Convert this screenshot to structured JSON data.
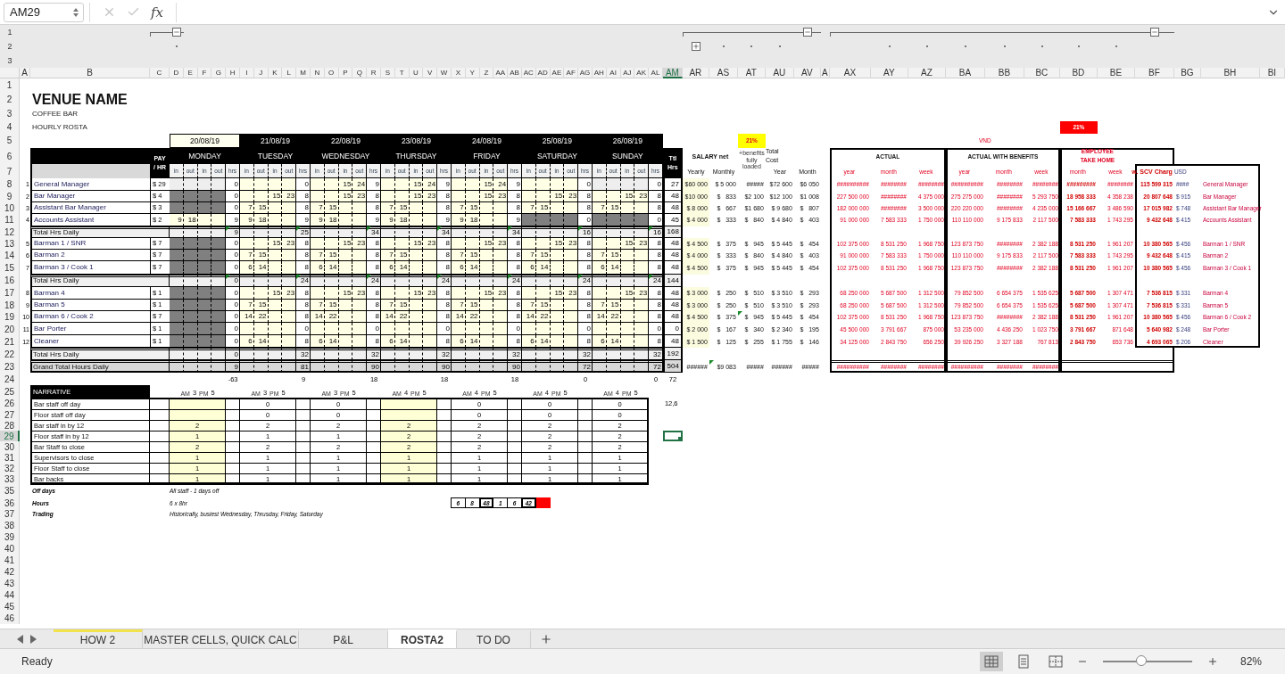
{
  "formula_bar": {
    "name_box": "AM29",
    "fx": "fx"
  },
  "outline": {
    "levels": [
      "1",
      "2",
      "3"
    ],
    "groups": [
      {
        "expanded": true
      },
      {
        "expanded": true
      },
      {
        "expanded": false
      },
      {
        "expanded": true
      }
    ]
  },
  "columns": [
    {
      "label": "A",
      "selected": false
    },
    {
      "label": "B",
      "selected": false
    },
    {
      "label": "C",
      "selected": false
    },
    {
      "label": "D",
      "selected": false
    },
    {
      "label": "E",
      "selected": false
    },
    {
      "label": "F",
      "selected": false
    },
    {
      "label": "G",
      "selected": false
    },
    {
      "label": "H",
      "selected": false
    },
    {
      "label": "I",
      "selected": false
    },
    {
      "label": "J",
      "selected": false
    },
    {
      "label": "K",
      "selected": false
    },
    {
      "label": "L",
      "selected": false
    },
    {
      "label": "M",
      "selected": false
    },
    {
      "label": "N",
      "selected": false
    },
    {
      "label": "O",
      "selected": false
    },
    {
      "label": "P",
      "selected": false
    },
    {
      "label": "Q",
      "selected": false
    },
    {
      "label": "R",
      "selected": false
    },
    {
      "label": "S",
      "selected": false
    },
    {
      "label": "T",
      "selected": false
    },
    {
      "label": "U",
      "selected": false
    },
    {
      "label": "V",
      "selected": false
    },
    {
      "label": "W",
      "selected": false
    },
    {
      "label": "X",
      "selected": false
    },
    {
      "label": "Y",
      "selected": false
    },
    {
      "label": "Z",
      "selected": false
    },
    {
      "label": "AA",
      "selected": false
    },
    {
      "label": "AB",
      "selected": false
    },
    {
      "label": "AC",
      "selected": false
    },
    {
      "label": "AD",
      "selected": false
    },
    {
      "label": "AE",
      "selected": false
    },
    {
      "label": "AF",
      "selected": false
    },
    {
      "label": "AG",
      "selected": false
    },
    {
      "label": "AH",
      "selected": false
    },
    {
      "label": "AI",
      "selected": false
    },
    {
      "label": "AJ",
      "selected": false
    },
    {
      "label": "AK",
      "selected": false
    },
    {
      "label": "AL",
      "selected": false
    },
    {
      "label": "AM",
      "selected": true
    },
    {
      "label": "AR",
      "selected": false
    },
    {
      "label": "AS",
      "selected": false
    },
    {
      "label": "AT",
      "selected": false
    },
    {
      "label": "AU",
      "selected": false
    },
    {
      "label": "AV",
      "selected": false
    },
    {
      "label": "A",
      "selected": false
    },
    {
      "label": "AX",
      "selected": false
    },
    {
      "label": "AY",
      "selected": false
    },
    {
      "label": "AZ",
      "selected": false
    },
    {
      "label": "BA",
      "selected": false
    },
    {
      "label": "BB",
      "selected": false
    },
    {
      "label": "BC",
      "selected": false
    },
    {
      "label": "BD",
      "selected": false
    },
    {
      "label": "BE",
      "selected": false
    },
    {
      "label": "BF",
      "selected": false
    },
    {
      "label": "BG",
      "selected": false
    },
    {
      "label": "BH",
      "selected": false
    },
    {
      "label": "BI",
      "selected": false
    }
  ],
  "rows": [
    {
      "label": "1",
      "selected": false
    },
    {
      "label": "2",
      "selected": false
    },
    {
      "label": "3",
      "selected": false
    },
    {
      "label": "4",
      "selected": false
    },
    {
      "label": "5",
      "selected": false
    },
    {
      "label": "6",
      "selected": false
    },
    {
      "label": "7",
      "selected": false
    },
    {
      "label": "8",
      "selected": false
    },
    {
      "label": "9",
      "selected": false
    },
    {
      "label": "10",
      "selected": false
    },
    {
      "label": "11",
      "selected": false
    },
    {
      "label": "12",
      "selected": false
    },
    {
      "label": "13",
      "selected": false
    },
    {
      "label": "14",
      "selected": false
    },
    {
      "label": "15",
      "selected": false
    },
    {
      "label": "16",
      "selected": false
    },
    {
      "label": "17",
      "selected": false
    },
    {
      "label": "18",
      "selected": false
    },
    {
      "label": "19",
      "selected": false
    },
    {
      "label": "20",
      "selected": false
    },
    {
      "label": "21",
      "selected": false
    },
    {
      "label": "22",
      "selected": false
    },
    {
      "label": "23",
      "selected": false
    },
    {
      "label": "24",
      "selected": false
    },
    {
      "label": "25",
      "selected": false
    },
    {
      "label": "26",
      "selected": false
    },
    {
      "label": "27",
      "selected": false
    },
    {
      "label": "28",
      "selected": false
    },
    {
      "label": "29",
      "selected": true
    },
    {
      "label": "30",
      "selected": false
    },
    {
      "label": "31",
      "selected": false
    },
    {
      "label": "32",
      "selected": false
    },
    {
      "label": "33",
      "selected": false
    },
    {
      "label": "35",
      "selected": false
    },
    {
      "label": "36",
      "selected": false
    },
    {
      "label": "37",
      "selected": false
    },
    {
      "label": "38",
      "selected": false
    },
    {
      "label": "39",
      "selected": false
    },
    {
      "label": "40",
      "selected": false
    },
    {
      "label": "41",
      "selected": false
    },
    {
      "label": "42",
      "selected": false
    },
    {
      "label": "43",
      "selected": false
    },
    {
      "label": "44",
      "selected": false
    },
    {
      "label": "45",
      "selected": false
    },
    {
      "label": "46",
      "selected": false
    }
  ],
  "title": "VENUE NAME",
  "subtitle": "COFFEE BAR",
  "sheet_name": "HOURLY ROSTA",
  "roster": {
    "pay_header": [
      "PAY",
      "/ HR"
    ],
    "total_header": [
      "Ttl",
      "Hrs"
    ],
    "days": [
      {
        "date": "20/08/19",
        "name": "MONDAY",
        "highlighted": true,
        "subheaders": [
          "in",
          "out",
          "in",
          "out",
          "hrs"
        ]
      },
      {
        "date": "21/08/19",
        "name": "TUESDAY",
        "highlighted": false,
        "subheaders": [
          "in",
          "out",
          "in",
          "out",
          "hrs"
        ]
      },
      {
        "date": "22/08/19",
        "name": "WEDNESDAY",
        "highlighted": false,
        "subheaders": [
          "in",
          "out",
          "in",
          "out",
          "hrs"
        ]
      },
      {
        "date": "23/08/19",
        "name": "THURSDAY",
        "highlighted": false,
        "subheaders": [
          "in",
          "out",
          "in",
          "out",
          "hrs"
        ]
      },
      {
        "date": "24/08/19",
        "name": "FRIDAY",
        "highlighted": false,
        "subheaders": [
          "in",
          "out",
          "in",
          "out",
          "hrs"
        ]
      },
      {
        "date": "25/08/19",
        "name": "SATURDAY",
        "highlighted": false,
        "subheaders": [
          "in",
          "out",
          "in",
          "out",
          "hrs"
        ]
      },
      {
        "date": "26/08/19",
        "name": "SUNDAY",
        "highlighted": false,
        "subheaders": [
          "in",
          "out",
          "in",
          "out",
          "hrs"
        ]
      }
    ],
    "groups": [
      {
        "staff": [
          {
            "no": "1",
            "name": "General Manager",
            "pay": "$ 29",
            "total": "27",
            "shifts": [
              {
                "kind": "empty",
                "hrs": "0"
              },
              {
                "kind": "work",
                "hrs": "0"
              },
              {
                "kind": "work",
                "second": [
                  "15",
                  "24"
                ],
                "hrs": "9"
              },
              {
                "kind": "work",
                "second": [
                  "15",
                  "24"
                ],
                "hrs": "9"
              },
              {
                "kind": "work",
                "second": [
                  "15",
                  "24"
                ],
                "hrs": "9"
              },
              {
                "kind": "work",
                "hrs": "0"
              },
              {
                "kind": "empty",
                "hrs": "0"
              }
            ]
          },
          {
            "no": "2",
            "name": "Bar Manager",
            "pay": "$ 4",
            "total": "48",
            "shifts": [
              {
                "kind": "off",
                "hrs": "0"
              },
              {
                "kind": "work",
                "second": [
                  "15",
                  "23"
                ],
                "hrs": "8"
              },
              {
                "kind": "work",
                "second": [
                  "15",
                  "23"
                ],
                "hrs": "8"
              },
              {
                "kind": "work",
                "second": [
                  "15",
                  "23"
                ],
                "hrs": "8"
              },
              {
                "kind": "work",
                "second": [
                  "15",
                  "23"
                ],
                "hrs": "8"
              },
              {
                "kind": "work",
                "second": [
                  "15",
                  "23"
                ],
                "hrs": "8"
              },
              {
                "kind": "work",
                "second": [
                  "15",
                  "23"
                ],
                "hrs": "8"
              }
            ]
          },
          {
            "no": "3",
            "name": "Assistant Bar Manager",
            "pay": "$ 3",
            "total": "48",
            "shifts": [
              {
                "kind": "off",
                "hrs": "0"
              },
              {
                "kind": "work",
                "first": [
                  "7",
                  "15"
                ],
                "hrs": "8"
              },
              {
                "kind": "work",
                "first": [
                  "7",
                  "15"
                ],
                "hrs": "8"
              },
              {
                "kind": "work",
                "first": [
                  "7",
                  "15"
                ],
                "hrs": "8"
              },
              {
                "kind": "work",
                "first": [
                  "7",
                  "15"
                ],
                "hrs": "8"
              },
              {
                "kind": "work",
                "first": [
                  "7",
                  "15"
                ],
                "hrs": "8"
              },
              {
                "kind": "work",
                "first": [
                  "7",
                  "15"
                ],
                "hrs": "8"
              }
            ]
          },
          {
            "no": "4",
            "name": "Accounts Assistant",
            "pay": "$ 2",
            "total": "45",
            "shifts": [
              {
                "kind": "work",
                "first": [
                  "9",
                  "18"
                ],
                "hrs": "9"
              },
              {
                "kind": "work",
                "first": [
                  "9",
                  "18"
                ],
                "hrs": "9"
              },
              {
                "kind": "work",
                "first": [
                  "9",
                  "18"
                ],
                "hrs": "9"
              },
              {
                "kind": "work",
                "first": [
                  "9",
                  "18"
                ],
                "hrs": "9"
              },
              {
                "kind": "work",
                "first": [
                  "9",
                  "18"
                ],
                "hrs": "9"
              },
              {
                "kind": "off",
                "hrs": "0"
              },
              {
                "kind": "off",
                "hrs": "0"
              }
            ]
          }
        ],
        "total": {
          "label": "Total Hrs Daily",
          "flagged": true,
          "days": [
            "9",
            "25",
            "34",
            "34",
            "34",
            "16",
            "16"
          ],
          "total": "168"
        }
      },
      {
        "staff": [
          {
            "no": "5",
            "name": "Barman 1 / SNR",
            "pay": "$ 7",
            "total": "48",
            "shifts": [
              {
                "kind": "off",
                "hrs": "0"
              },
              {
                "kind": "work",
                "second": [
                  "15",
                  "23"
                ],
                "hrs": "8"
              },
              {
                "kind": "work",
                "second": [
                  "15",
                  "23"
                ],
                "hrs": "8"
              },
              {
                "kind": "work",
                "second": [
                  "15",
                  "23"
                ],
                "hrs": "8"
              },
              {
                "kind": "work",
                "second": [
                  "15",
                  "23"
                ],
                "hrs": "8"
              },
              {
                "kind": "work",
                "second": [
                  "15",
                  "23"
                ],
                "hrs": "8"
              },
              {
                "kind": "work",
                "second": [
                  "15",
                  "23"
                ],
                "hrs": "8"
              }
            ]
          },
          {
            "no": "6",
            "name": "Barman 2",
            "pay": "$ 7",
            "total": "48",
            "shifts": [
              {
                "kind": "off",
                "hrs": "0"
              },
              {
                "kind": "work",
                "first": [
                  "7",
                  "15"
                ],
                "hrs": "8"
              },
              {
                "kind": "work",
                "first": [
                  "7",
                  "15"
                ],
                "hrs": "8"
              },
              {
                "kind": "work",
                "first": [
                  "7",
                  "15"
                ],
                "hrs": "8"
              },
              {
                "kind": "work",
                "first": [
                  "7",
                  "15"
                ],
                "hrs": "8"
              },
              {
                "kind": "work",
                "first": [
                  "7",
                  "15"
                ],
                "hrs": "8"
              },
              {
                "kind": "work",
                "first": [
                  "7",
                  "15"
                ],
                "hrs": "8"
              }
            ]
          },
          {
            "no": "7",
            "name": "Barman 3 / Cook 1",
            "pay": "$ 7",
            "total": "48",
            "shifts": [
              {
                "kind": "off",
                "hrs": "0"
              },
              {
                "kind": "work",
                "first": [
                  "6",
                  "14"
                ],
                "hrs": "8"
              },
              {
                "kind": "work",
                "first": [
                  "6",
                  "14"
                ],
                "hrs": "8"
              },
              {
                "kind": "work",
                "first": [
                  "6",
                  "14"
                ],
                "hrs": "8"
              },
              {
                "kind": "work",
                "first": [
                  "6",
                  "14"
                ],
                "hrs": "8"
              },
              {
                "kind": "work",
                "first": [
                  "6",
                  "14"
                ],
                "hrs": "8"
              },
              {
                "kind": "work",
                "first": [
                  "6",
                  "14"
                ],
                "hrs": "8"
              }
            ]
          }
        ],
        "total": {
          "label": "Total Hrs Daily",
          "flagged": true,
          "days": [
            "0",
            "24",
            "24",
            "24",
            "24",
            "24",
            "24"
          ],
          "total": "144"
        }
      },
      {
        "staff": [
          {
            "no": "8",
            "name": "Barman 4",
            "pay": "$ 1",
            "total": "48",
            "shifts": [
              {
                "kind": "off",
                "hrs": "0"
              },
              {
                "kind": "work",
                "second": [
                  "15",
                  "23"
                ],
                "hrs": "8"
              },
              {
                "kind": "work",
                "second": [
                  "15",
                  "23"
                ],
                "hrs": "8"
              },
              {
                "kind": "work",
                "second": [
                  "15",
                  "23"
                ],
                "hrs": "8"
              },
              {
                "kind": "work",
                "second": [
                  "15",
                  "23"
                ],
                "hrs": "8"
              },
              {
                "kind": "work",
                "second": [
                  "15",
                  "23"
                ],
                "hrs": "8"
              },
              {
                "kind": "work",
                "second": [
                  "15",
                  "23"
                ],
                "hrs": "8"
              }
            ]
          },
          {
            "no": "9",
            "name": "Barman 5",
            "pay": "$ 1",
            "total": "48",
            "shifts": [
              {
                "kind": "off",
                "hrs": "0"
              },
              {
                "kind": "work",
                "first": [
                  "7",
                  "15"
                ],
                "hrs": "8"
              },
              {
                "kind": "work",
                "first": [
                  "7",
                  "15"
                ],
                "hrs": "8"
              },
              {
                "kind": "work",
                "first": [
                  "7",
                  "15"
                ],
                "hrs": "8"
              },
              {
                "kind": "work",
                "first": [
                  "7",
                  "15"
                ],
                "hrs": "8"
              },
              {
                "kind": "work",
                "first": [
                  "7",
                  "15"
                ],
                "hrs": "8"
              },
              {
                "kind": "work",
                "first": [
                  "7",
                  "15"
                ],
                "hrs": "8"
              }
            ]
          },
          {
            "no": "10",
            "name": "Barman 6 / Cook 2",
            "pay": "$ 7",
            "total": "48",
            "shifts": [
              {
                "kind": "off",
                "hrs": "0"
              },
              {
                "kind": "work",
                "first": [
                  "14",
                  "22"
                ],
                "hrs": "8"
              },
              {
                "kind": "work",
                "first": [
                  "14",
                  "22"
                ],
                "hrs": "8"
              },
              {
                "kind": "work",
                "first": [
                  "14",
                  "22"
                ],
                "hrs": "8"
              },
              {
                "kind": "work",
                "first": [
                  "14",
                  "22"
                ],
                "hrs": "8"
              },
              {
                "kind": "work",
                "first": [
                  "14",
                  "22"
                ],
                "hrs": "8"
              },
              {
                "kind": "work",
                "first": [
                  "14",
                  "22"
                ],
                "hrs": "8"
              }
            ]
          },
          {
            "no": "11",
            "name": "Bar Porter",
            "pay": "$ 1",
            "total": "0",
            "shifts": [
              {
                "kind": "off",
                "hrs": "0"
              },
              {
                "kind": "work",
                "hrs": "0"
              },
              {
                "kind": "work",
                "hrs": "0"
              },
              {
                "kind": "work",
                "hrs": "0"
              },
              {
                "kind": "work",
                "hrs": "0"
              },
              {
                "kind": "work",
                "hrs": "0"
              },
              {
                "kind": "work",
                "hrs": "0"
              }
            ]
          },
          {
            "no": "12",
            "name": "Cleaner",
            "pay": "$ 1",
            "total": "48",
            "shifts": [
              {
                "kind": "off",
                "hrs": "0"
              },
              {
                "kind": "work",
                "first": [
                  "6",
                  "14"
                ],
                "hrs": "8"
              },
              {
                "kind": "work",
                "first": [
                  "6",
                  "14"
                ],
                "hrs": "8"
              },
              {
                "kind": "work",
                "first": [
                  "6",
                  "14"
                ],
                "hrs": "8"
              },
              {
                "kind": "work",
                "first": [
                  "6",
                  "14"
                ],
                "hrs": "8"
              },
              {
                "kind": "work",
                "first": [
                  "6",
                  "14"
                ],
                "hrs": "8"
              },
              {
                "kind": "work",
                "first": [
                  "6",
                  "14"
                ],
                "hrs": "8"
              }
            ]
          }
        ],
        "total": {
          "label": "Total Hrs Daily",
          "flagged": false,
          "days": [
            "0",
            "32",
            "32",
            "32",
            "32",
            "32",
            "32"
          ],
          "total": "192"
        }
      }
    ],
    "grand_total": {
      "label": "Grand Total Hours Daily",
      "days": [
        "9",
        "81",
        "90",
        "90",
        "90",
        "72",
        "72"
      ],
      "total": "504"
    },
    "balance": {
      "days": [
        "-63",
        "9",
        "18",
        "18",
        "18",
        "0",
        "0"
      ],
      "total": "72"
    }
  },
  "salary": {
    "rate_badge": "21%",
    "title": "SALARY net",
    "benefits_note": "+benefits fully loaded",
    "total_cost": [
      "Total",
      "Cost"
    ],
    "columns": [
      "Yearly",
      "Monthly",
      "Year",
      "Month"
    ],
    "rows": [
      {
        "yearly": "$60 000",
        "monthly": "$ 5 000",
        "benefits": "#####",
        "year": "$72 600",
        "month": "$6 050",
        "flagged": false
      },
      {
        "yearly": "$10 000",
        "monthly": "$   833",
        "benefits": "$2 100",
        "year": "$12 100",
        "month": "$1 008",
        "flagged": false
      },
      {
        "yearly": "$ 8 000",
        "monthly": "$   667",
        "benefits": "$1 680",
        "year": "$ 9 680",
        "month": "$   807",
        "flagged": false
      },
      {
        "yearly": "$ 4 000",
        "monthly": "$   333",
        "benefits": "$   840",
        "year": "$ 4 840",
        "month": "$   403",
        "flagged": false
      },
      {
        "yearly": "$ 4 500",
        "monthly": "$   375",
        "benefits": "$   945",
        "year": "$ 5 445",
        "month": "$   454",
        "flagged": false
      },
      {
        "yearly": "$ 4 000",
        "monthly": "$   333",
        "benefits": "$   840",
        "year": "$ 4 840",
        "month": "$   403",
        "flagged": false
      },
      {
        "yearly": "$ 4 500",
        "monthly": "$   375",
        "benefits": "$   945",
        "year": "$ 5 445",
        "month": "$   454",
        "flagged": false
      },
      {
        "yearly": "$ 3 000",
        "monthly": "$   250",
        "benefits": "$   510",
        "year": "$ 3 510",
        "month": "$   293",
        "flagged": false
      },
      {
        "yearly": "$ 3 000",
        "monthly": "$   250",
        "benefits": "$   510",
        "year": "$ 3 510",
        "month": "$   293",
        "flagged": false
      },
      {
        "yearly": "$ 4 500",
        "monthly": "$   375",
        "benefits": "$   945",
        "year": "$ 5 445",
        "month": "$   454",
        "flagged": true
      },
      {
        "yearly": "$ 2 000",
        "monthly": "$   167",
        "benefits": "$   340",
        "year": "$ 2 340",
        "month": "$   195",
        "flagged": false
      },
      {
        "yearly": "$ 1 500",
        "monthly": "$   125",
        "benefits": "$   255",
        "year": "$ 1 755",
        "month": "$   146",
        "flagged": false
      }
    ],
    "grand": {
      "yearly": "######",
      "monthly": "$9 083",
      "benefits": "#####",
      "year": "######",
      "month": "#####",
      "flagged": true
    }
  },
  "vnd": {
    "currency": "VND",
    "actual_title": "ACTUAL",
    "benefits_title": "ACTUAL WITH BENEFITS",
    "actual_columns": [
      "year",
      "month",
      "week"
    ],
    "benefits_columns": [
      "year",
      "month",
      "week"
    ],
    "rows": [
      {
        "actual": [
          "##########",
          "########",
          "########"
        ],
        "benefits": [
          "##########",
          "########",
          "########"
        ]
      },
      {
        "actual": [
          "227 500 000",
          "########",
          "4 375 000"
        ],
        "benefits": [
          "275 275 000",
          "########",
          "5 293 750"
        ]
      },
      {
        "actual": [
          "182 000 000",
          "########",
          "3 500 000"
        ],
        "benefits": [
          "220 220 000",
          "########",
          "4 235 000"
        ]
      },
      {
        "actual": [
          "91 000 000",
          "7 583 333",
          "1 750 000"
        ],
        "benefits": [
          "110 110 000",
          "9 175 833",
          "2 117 500"
        ]
      },
      {
        "actual": [
          "102 375 000",
          "8 531 250",
          "1 968 750"
        ],
        "benefits": [
          "123 873 750",
          "########",
          "2 382 188"
        ]
      },
      {
        "actual": [
          "91 000 000",
          "7 583 333",
          "1 750 000"
        ],
        "benefits": [
          "110 110 000",
          "9 175 833",
          "2 117 500"
        ]
      },
      {
        "actual": [
          "102 375 000",
          "8 531 250",
          "1 968 750"
        ],
        "benefits": [
          "123 873 750",
          "########",
          "2 382 188"
        ]
      },
      {
        "actual": [
          "68 250 000",
          "5 687 500",
          "1 312 500"
        ],
        "benefits": [
          "79 852 500",
          "6 654 375",
          "1 535 625"
        ]
      },
      {
        "actual": [
          "68 250 000",
          "5 687 500",
          "1 312 500"
        ],
        "benefits": [
          "79 852 500",
          "6 654 375",
          "1 535 625"
        ]
      },
      {
        "actual": [
          "102 375 000",
          "8 531 250",
          "1 968 750"
        ],
        "benefits": [
          "123 873 750",
          "########",
          "2 382 188"
        ]
      },
      {
        "actual": [
          "45 500 000",
          "3 791 667",
          "875 000"
        ],
        "benefits": [
          "53 235 000",
          "4 436 250",
          "1 023 750"
        ]
      },
      {
        "actual": [
          "34 125 000",
          "2 843 750",
          "656 250"
        ],
        "benefits": [
          "39 926 250",
          "3 327 188",
          "767 813"
        ]
      }
    ],
    "grand": {
      "actual": [
        "##########",
        "########",
        "########"
      ],
      "benefits": [
        "##########",
        "########",
        "########"
      ]
    }
  },
  "take_home": {
    "rate_badge": "21%",
    "title": [
      "EMPLOYEE",
      "TAKE HOME"
    ],
    "columns": [
      "month",
      "week"
    ],
    "rows": [
      [
        "#########",
        "########"
      ],
      [
        "18 958 333",
        "4 358 238"
      ],
      [
        "15 166 667",
        "3 486 590"
      ],
      [
        "7 583 333",
        "1 743 295"
      ],
      [
        "8 531 250",
        "1 961 207"
      ],
      [
        "7 583 333",
        "1 743 295"
      ],
      [
        "8 531 250",
        "1 961 207"
      ],
      [
        "5 687 500",
        "1 307 471"
      ],
      [
        "5 687 500",
        "1 307 471"
      ],
      [
        "8 531 250",
        "1 961 207"
      ],
      [
        "3 791 667",
        "871 648"
      ],
      [
        "2 843 750",
        "653 736"
      ]
    ]
  },
  "service_charge": {
    "columns": [
      "w. SCV Charg",
      "USD"
    ],
    "rows": [
      {
        "vnd": "115 599 315",
        "usd": "####",
        "name": "General Manager"
      },
      {
        "vnd": "20 807 648",
        "usd": "$ 915",
        "name": "Bar Manager"
      },
      {
        "vnd": "17 015 982",
        "usd": "$ 748",
        "name": "Assistant Bar Manager"
      },
      {
        "vnd": "9 432 648",
        "usd": "$ 415",
        "name": "Accounts Assistant"
      },
      {
        "vnd": "10 380 565",
        "usd": "$ 456",
        "name": "Barman 1 / SNR"
      },
      {
        "vnd": "9 432 648",
        "usd": "$ 415",
        "name": "Barman 2"
      },
      {
        "vnd": "10 380 565",
        "usd": "$ 456",
        "name": "Barman 3 / Cook 1"
      },
      {
        "vnd": "7 536 815",
        "usd": "$ 331",
        "name": "Barman 4"
      },
      {
        "vnd": "7 536 815",
        "usd": "$ 331",
        "name": "Barman 5"
      },
      {
        "vnd": "10 380 565",
        "usd": "$ 456",
        "name": "Barman 6 / Cook 2"
      },
      {
        "vnd": "5 640 982",
        "usd": "$ 248",
        "name": "Bar Porter"
      },
      {
        "vnd": "4 693 065",
        "usd": "$ 206",
        "name": "Cleaner"
      }
    ]
  },
  "narrative": {
    "title": "NARRATIVE",
    "side_note": "12,6",
    "days": [
      {
        "am_label": "AM",
        "am": "3",
        "pm_label": "PM",
        "pm": "5",
        "highlighted": true
      },
      {
        "am_label": "AM",
        "am": "3",
        "pm_label": "PM",
        "pm": "5",
        "highlighted": false
      },
      {
        "am_label": "AM",
        "am": "3",
        "pm_label": "PM",
        "pm": "5",
        "highlighted": false
      },
      {
        "am_label": "AM",
        "am": "4",
        "pm_label": "PM",
        "pm": "5",
        "highlighted": true
      },
      {
        "am_label": "AM",
        "am": "4",
        "pm_label": "PM",
        "pm": "5",
        "highlighted": false
      },
      {
        "am_label": "AM",
        "am": "4",
        "pm_label": "PM",
        "pm": "5",
        "highlighted": false
      },
      {
        "am_label": "AM",
        "am": "4",
        "pm_label": "PM",
        "pm": "5",
        "highlighted": false
      }
    ],
    "rows": [
      {
        "label": "Bar staff off day",
        "cells": [
          {
            "blank": true
          },
          {
            "value": "0"
          },
          {
            "value": "0"
          },
          {
            "blank": true
          },
          {
            "value": "0"
          },
          {
            "value": "0"
          },
          {
            "value": "0"
          }
        ]
      },
      {
        "label": "Floor staff off day",
        "cells": [
          {
            "blank": true
          },
          {
            "value": "0"
          },
          {
            "value": "0"
          },
          {
            "blank": true
          },
          {
            "value": "0"
          },
          {
            "value": "0"
          },
          {
            "value": "0"
          }
        ]
      },
      {
        "label": "Bar staff in by 12",
        "cells": [
          {
            "value": "2"
          },
          {
            "value": "2"
          },
          {
            "value": "2"
          },
          {
            "value": "2"
          },
          {
            "value": "2"
          },
          {
            "value": "2"
          },
          {
            "value": "2"
          }
        ]
      },
      {
        "label": "Floor staff in by 12",
        "cells": [
          {
            "value": "1"
          },
          {
            "value": "1"
          },
          {
            "value": "1"
          },
          {
            "value": "2"
          },
          {
            "value": "2"
          },
          {
            "value": "2"
          },
          {
            "value": "2"
          }
        ]
      },
      {
        "label": "Bar Staff to close",
        "cells": [
          {
            "value": "2"
          },
          {
            "value": "2"
          },
          {
            "value": "2"
          },
          {
            "value": "2"
          },
          {
            "value": "2"
          },
          {
            "value": "2"
          },
          {
            "value": "2"
          }
        ]
      },
      {
        "label": "Supervisors to close",
        "cells": [
          {
            "value": "1"
          },
          {
            "value": "1"
          },
          {
            "value": "1"
          },
          {
            "value": "1"
          },
          {
            "value": "1"
          },
          {
            "value": "1"
          },
          {
            "value": "1"
          }
        ]
      },
      {
        "label": "Floor Staff to close",
        "cells": [
          {
            "value": "1"
          },
          {
            "value": "1"
          },
          {
            "value": "1"
          },
          {
            "value": "1"
          },
          {
            "value": "1"
          },
          {
            "value": "1"
          },
          {
            "value": "1"
          }
        ]
      },
      {
        "label": "Bar backs",
        "cells": [
          {
            "value": "1"
          },
          {
            "value": "1"
          },
          {
            "value": "1"
          },
          {
            "value": "1"
          },
          {
            "value": "1"
          },
          {
            "value": "1"
          },
          {
            "value": "1"
          }
        ]
      }
    ]
  },
  "notes": [
    {
      "label": "Off days",
      "text": "All staff - 1 days off"
    },
    {
      "label": "Hours",
      "text": "6 x 8hr"
    },
    {
      "label": "Trading",
      "text": "Historically, busiest Wednesday, Thrusday, Friday, Saturday"
    }
  ],
  "check_cells": {
    "cells": [
      {
        "value": "6",
        "emphasis": false
      },
      {
        "value": "8",
        "emphasis": false
      },
      {
        "value": "48",
        "emphasis": true
      },
      {
        "value": "1",
        "emphasis": false
      },
      {
        "value": "6",
        "emphasis": false
      },
      {
        "value": "42",
        "emphasis": true
      }
    ],
    "alert": true
  },
  "sheet_tabs": [
    {
      "label": "HOW 2",
      "selected": false,
      "color": "#f2e34c"
    },
    {
      "label": "MASTER CELLS, QUICK CALC",
      "selected": false
    },
    {
      "label": "P&L",
      "selected": false
    },
    {
      "label": "ROSTA2",
      "selected": true
    },
    {
      "label": "TO DO",
      "selected": false
    }
  ],
  "status_bar": {
    "status": "Ready",
    "views": [
      {
        "selected": true
      },
      {
        "selected": false
      },
      {
        "selected": false
      }
    ],
    "zoom": {
      "level": 0.43,
      "reading": "82%"
    }
  }
}
